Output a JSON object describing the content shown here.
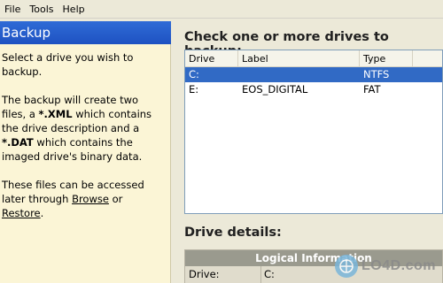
{
  "menu": [
    {
      "label": "File"
    },
    {
      "label": "Tools"
    },
    {
      "label": "Help"
    }
  ],
  "left": {
    "title": "Backup",
    "para1": "Select a drive you wish to backup.",
    "para2_a": "The backup will create two files, a ",
    "para2_xml": "*.XML",
    "para2_b": " which contains the drive description and a ",
    "para2_dat": "*.DAT",
    "para2_c": " which contains the imaged drive's binary data.",
    "para3_a": "These files can be accessed later through ",
    "browse_link": "Browse",
    "para3_or": " or ",
    "restore_link": "Restore",
    "para3_end": "."
  },
  "right": {
    "backup_title": "Check one or more drives to backup:",
    "columns": [
      "Drive",
      "Label",
      "Type"
    ],
    "drives": [
      {
        "drive": "C:",
        "label": "",
        "type": "NTFS",
        "selected": true
      },
      {
        "drive": "E:",
        "label": "EOS_DIGITAL",
        "type": "FAT",
        "selected": false
      }
    ],
    "details_title": "Drive details:",
    "info_header": "Logical Information",
    "info_rows": [
      {
        "key": "Drive:",
        "value": "C:"
      }
    ]
  },
  "watermark": {
    "text": "LO4D.com"
  }
}
